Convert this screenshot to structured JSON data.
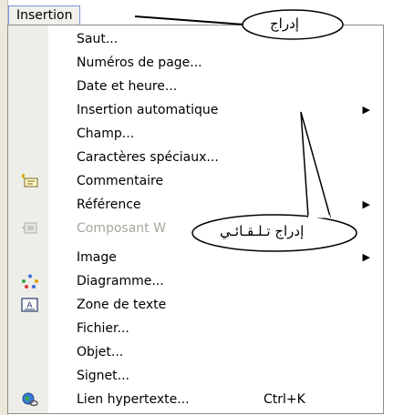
{
  "menu": {
    "title": "Insertion",
    "items": [
      {
        "label": "Saut...",
        "disabled": false,
        "submenu": false,
        "icon": ""
      },
      {
        "label": "Numéros de page...",
        "disabled": false,
        "submenu": false,
        "icon": ""
      },
      {
        "label": "Date et heure...",
        "disabled": false,
        "submenu": false,
        "icon": ""
      },
      {
        "label": "Insertion automatique",
        "disabled": false,
        "submenu": true,
        "icon": ""
      },
      {
        "label": "Champ...",
        "disabled": false,
        "submenu": false,
        "icon": ""
      },
      {
        "label": "Caractères spéciaux...",
        "disabled": false,
        "submenu": false,
        "icon": ""
      },
      {
        "label": "Commentaire",
        "disabled": false,
        "submenu": false,
        "icon": "comment-icon"
      },
      {
        "label": "Référence",
        "disabled": false,
        "submenu": true,
        "icon": ""
      },
      {
        "label": "Composant W",
        "disabled": true,
        "submenu": false,
        "icon": "web-component-icon"
      },
      {
        "label": "Image",
        "disabled": false,
        "submenu": true,
        "icon": ""
      },
      {
        "label": "Diagramme...",
        "disabled": false,
        "submenu": false,
        "icon": "diagram-icon"
      },
      {
        "label": "Zone de texte",
        "disabled": false,
        "submenu": false,
        "icon": "text-box-icon"
      },
      {
        "label": "Fichier...",
        "disabled": false,
        "submenu": false,
        "icon": ""
      },
      {
        "label": "Objet...",
        "disabled": false,
        "submenu": false,
        "icon": ""
      },
      {
        "label": "Signet...",
        "disabled": false,
        "submenu": false,
        "icon": ""
      },
      {
        "label": "Lien hypertexte...",
        "disabled": false,
        "submenu": false,
        "icon": "hyperlink-globe-icon",
        "shortcut": "Ctrl+K"
      }
    ],
    "submenu_arrow": "▶"
  },
  "callouts": {
    "insert": "إدراج",
    "autotext": "إدراج تـلـقـائـي"
  },
  "colors": {
    "gutter": "#eeeee8",
    "disabled_text": "#a7a69c",
    "menu_border": "#8c8c8c"
  }
}
